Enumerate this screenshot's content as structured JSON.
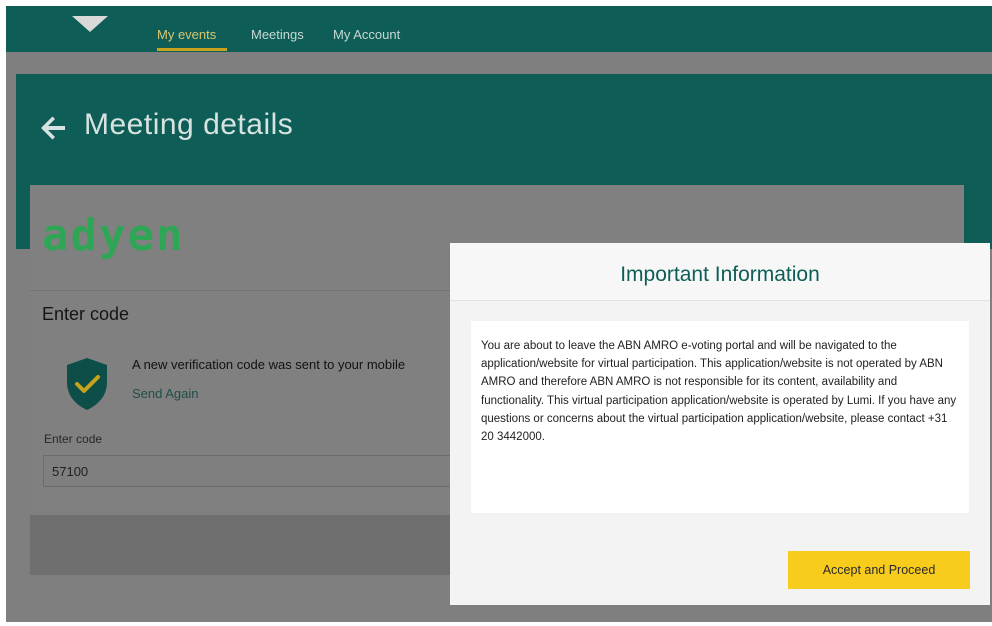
{
  "nav": {
    "items": [
      {
        "label": "My events",
        "active": true
      },
      {
        "label": "Meetings",
        "active": false
      },
      {
        "label": "My Account",
        "active": false
      }
    ]
  },
  "header": {
    "back_icon": "arrow-left-icon",
    "title": "Meeting details"
  },
  "card": {
    "logo_text": "adyen",
    "heading": "Enter code",
    "shield_icon": "shield-check-icon",
    "verification_message": "A new verification code was sent to your mobile",
    "send_again": "Send Again",
    "code_label": "Enter code",
    "code_value": "57100"
  },
  "modal": {
    "title": "Important Information",
    "body": "You are about to leave the ABN AMRO e-voting portal and will be navigated to the application/website for virtual participation. This application/website is not operated by ABN AMRO and therefore ABN AMRO is not responsible for its content, availability and functionality. This virtual participation application/website is operated by Lumi. If you have any questions or concerns about the virtual participation application/website, please contact +31 20 3442000.",
    "accept_label": "Accept and Proceed"
  },
  "colors": {
    "brand_teal": "#0e5d56",
    "accent_yellow": "#f7cc1d",
    "logo_green": "#2fa655"
  }
}
